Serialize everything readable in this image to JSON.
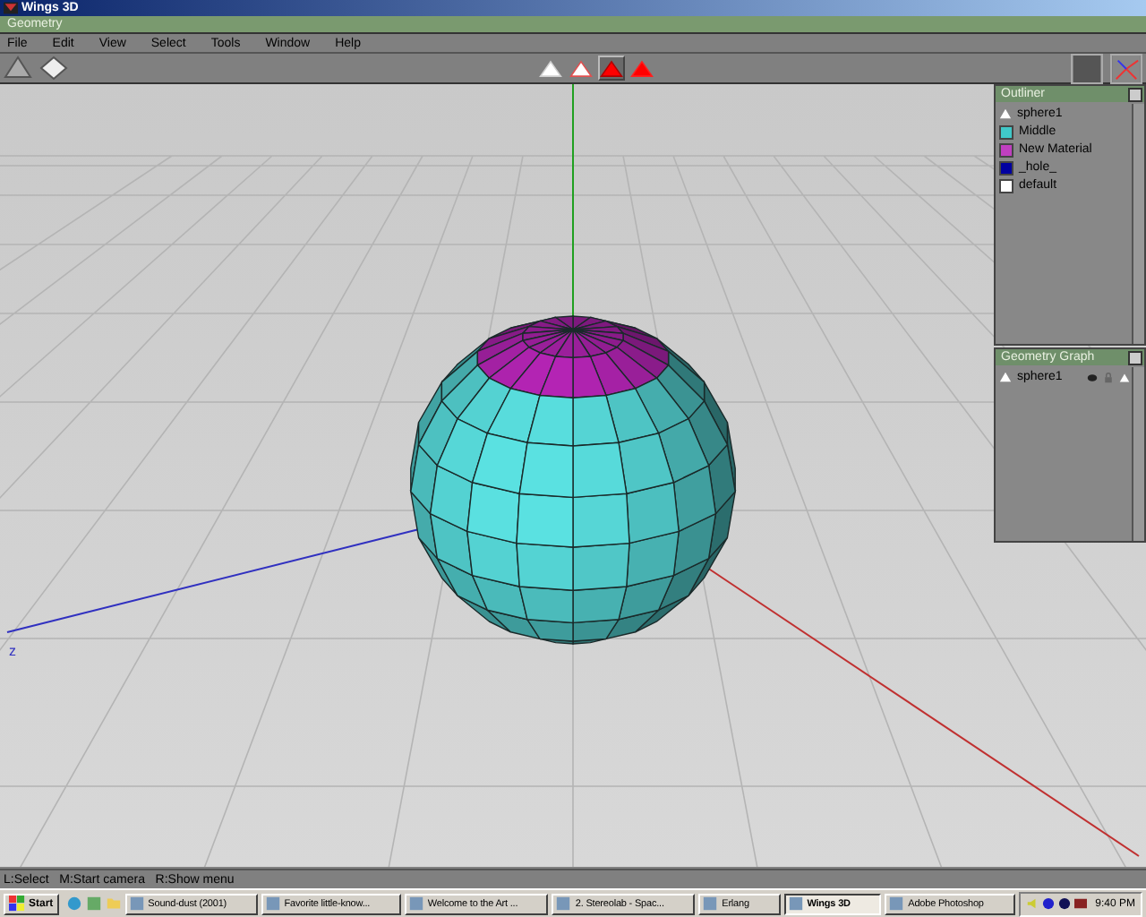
{
  "window": {
    "title": "Wings 3D"
  },
  "geometry_bar": {
    "title": "Geometry"
  },
  "menu": [
    "File",
    "Edit",
    "View",
    "Select",
    "Tools",
    "Window",
    "Help"
  ],
  "selection_modes": [
    {
      "selected": false
    },
    {
      "selected": false
    },
    {
      "selected": true
    },
    {
      "selected": false
    }
  ],
  "viewport": {
    "axis_label": "z"
  },
  "outliner": {
    "title": "Outliner",
    "items": [
      {
        "label": "sphere1",
        "kind": "object",
        "color": "#ffffff"
      },
      {
        "label": "Middle",
        "kind": "material",
        "color": "#40c8c8"
      },
      {
        "label": "New Material",
        "kind": "material",
        "color": "#c040c0"
      },
      {
        "label": "_hole_",
        "kind": "material",
        "color": "#0000a0"
      },
      {
        "label": "default",
        "kind": "material",
        "color": "#ffffff"
      }
    ]
  },
  "geometry_graph": {
    "title": "Geometry Graph",
    "items": [
      {
        "label": "sphere1"
      }
    ]
  },
  "status_bar": {
    "text": "L:Select   M:Start camera   R:Show menu"
  },
  "taskbar": {
    "start": "Start",
    "tasks": [
      {
        "label": "Sound-dust (2001)",
        "selected": false
      },
      {
        "label": "Favorite little-know...",
        "selected": false
      },
      {
        "label": "Welcome to the Art ...",
        "selected": false
      },
      {
        "label": "2. Stereolab - Spac...",
        "selected": false
      },
      {
        "label": "Erlang",
        "selected": false
      },
      {
        "label": "Wings 3D",
        "selected": true
      },
      {
        "label": "Adobe Photoshop",
        "selected": false
      }
    ],
    "clock": "9:40 PM"
  }
}
